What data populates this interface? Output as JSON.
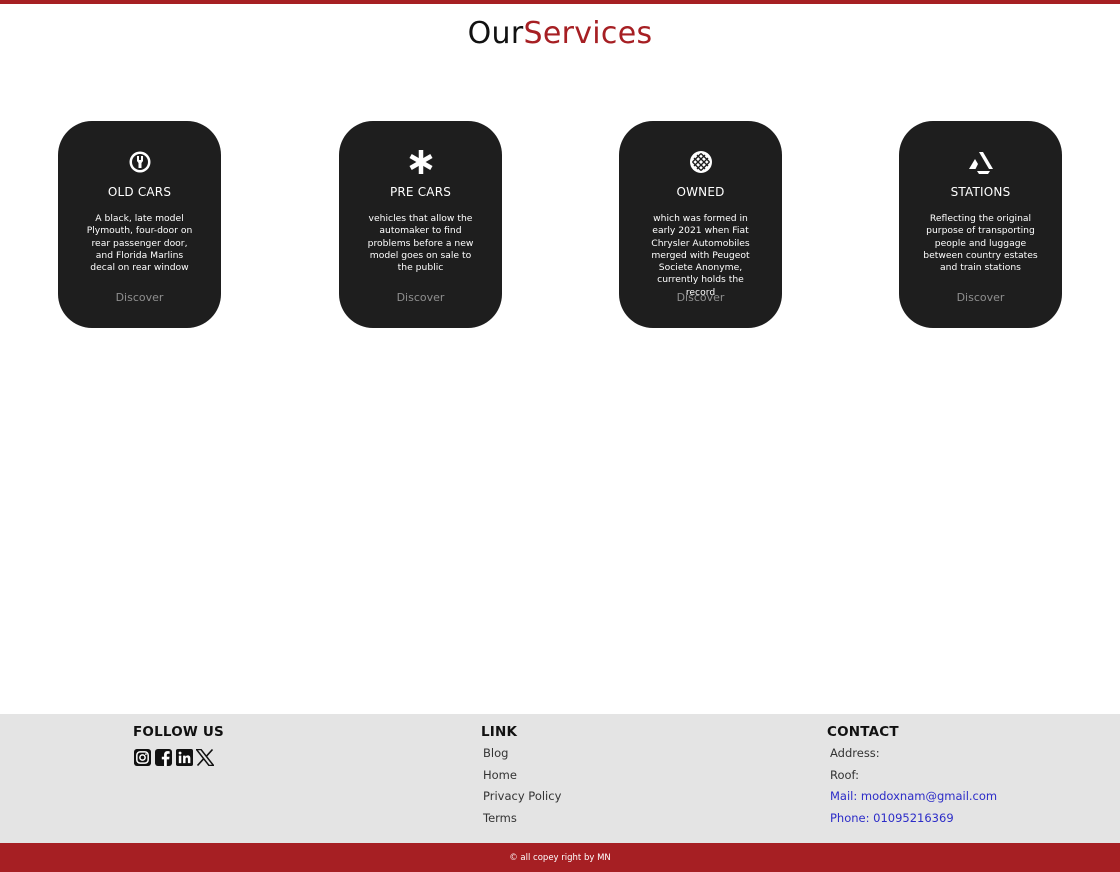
{
  "header": {
    "title_part1": "Our",
    "title_part2": "Services"
  },
  "cards": [
    {
      "icon": "old-cars-icon",
      "name": "OLD CARS",
      "description": "A black, late model Plymouth, four-door on rear passenger door, and Florida Marlins decal on rear window",
      "link": "Discover"
    },
    {
      "icon": "asterisk-icon",
      "name": "PRE CARS",
      "description": "vehicles that allow the automaker to find problems before a new model goes on sale to the public",
      "link": "Discover"
    },
    {
      "icon": "grid-globe-icon",
      "name": "OWNED",
      "description": "which was formed in early 2021 when Fiat Chrysler Automobiles merged with Peugeot Societe Anonyme, currently holds the record",
      "link": "Discover"
    },
    {
      "icon": "artstation-icon",
      "name": "STATIONS",
      "description": "Reflecting the original purpose of transporting people and luggage between country estates and train stations",
      "link": "Discover"
    }
  ],
  "footer": {
    "follow_title": "FOLLOW US",
    "social": [
      "instagram-icon",
      "facebook-icon",
      "linkedin-icon",
      "x-twitter-icon"
    ],
    "link_title": "LINK",
    "links": [
      "Blog",
      "Home",
      "Privacy Policy",
      "Terms"
    ],
    "contact_title": "CONTACT",
    "contact": [
      "Address:",
      "Roof:",
      "Mail: modoxnam@gmail.com",
      "Phone: 01095216369"
    ]
  },
  "copyright": "© all copey right by MN",
  "colors": {
    "accent": "#a61f23",
    "card_bg": "#1e1e1e",
    "footer_bg": "#e4e4e4",
    "contact_link": "#2c2cc8"
  }
}
